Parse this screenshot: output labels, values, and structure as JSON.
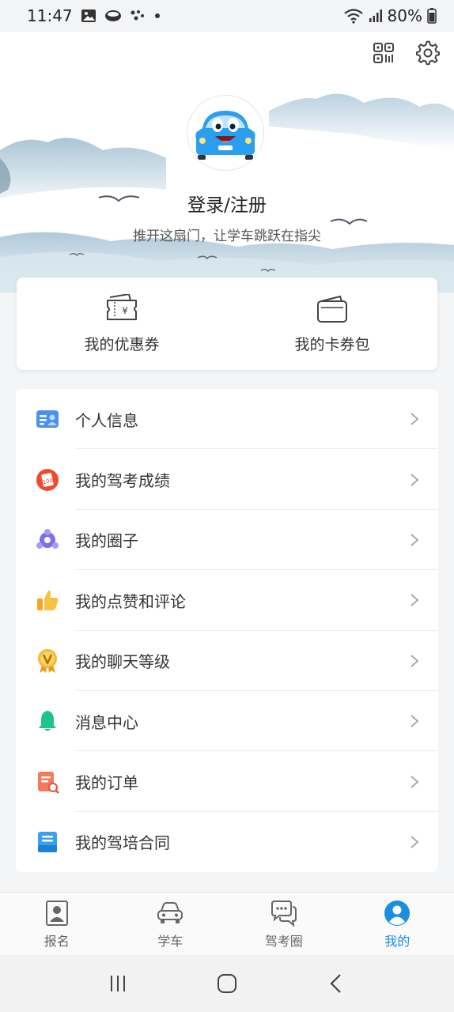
{
  "status_bar": {
    "time": "11:47",
    "battery": "80%"
  },
  "header": {
    "login_label": "登录/注册",
    "slogan": "推开这扇门，让学车跳跃在指尖"
  },
  "wallet": {
    "coupons_label": "我的优惠券",
    "card_wallet_label": "我的卡券包"
  },
  "menu": {
    "items": [
      {
        "label": "个人信息",
        "icon": "id-card-icon"
      },
      {
        "label": "我的驾考成绩",
        "icon": "exam-score-icon"
      },
      {
        "label": "我的圈子",
        "icon": "circle-group-icon"
      },
      {
        "label": "我的点赞和评论",
        "icon": "thumbs-up-icon"
      },
      {
        "label": "我的聊天等级",
        "icon": "vip-medal-icon"
      },
      {
        "label": "消息中心",
        "icon": "bell-icon"
      },
      {
        "label": "我的订单",
        "icon": "order-icon"
      },
      {
        "label": "我的驾培合同",
        "icon": "contract-icon"
      }
    ]
  },
  "bottom_nav": {
    "items": [
      {
        "label": "报名",
        "icon": "enroll-icon",
        "active": false
      },
      {
        "label": "学车",
        "icon": "car-icon",
        "active": false
      },
      {
        "label": "驾考圈",
        "icon": "chat-bubbles-icon",
        "active": false
      },
      {
        "label": "我的",
        "icon": "user-icon",
        "active": true
      }
    ]
  },
  "colors": {
    "accent": "#1a8fe0",
    "background": "#f4f5f7"
  }
}
